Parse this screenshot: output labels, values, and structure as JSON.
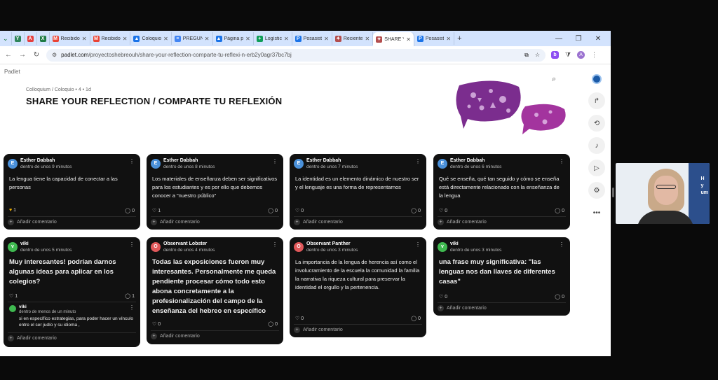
{
  "browser": {
    "tabs": [
      {
        "label": "",
        "fav": "Y",
        "color": "#2f855a"
      },
      {
        "label": "",
        "fav": "A",
        "color": "#e53e3e"
      },
      {
        "label": "",
        "fav": "X",
        "color": "#1e7b45"
      },
      {
        "label": "Recibido",
        "fav": "M",
        "color": "#ea4335"
      },
      {
        "label": "Recibido",
        "fav": "M",
        "color": "#ea4335"
      },
      {
        "label": "Coloquio",
        "fav": "▲",
        "color": "#1a73e8"
      },
      {
        "label": "PREGUN",
        "fav": "≡",
        "color": "#4285f4"
      },
      {
        "label": "Página p",
        "fav": "▲",
        "color": "#1a73e8"
      },
      {
        "label": "Logístic",
        "fav": "+",
        "color": "#0f9d58"
      },
      {
        "label": "Posasist",
        "fav": "P",
        "color": "#1a73e8"
      },
      {
        "label": "Reciente",
        "fav": "✦",
        "color": "#b34d4d"
      },
      {
        "label": "SHARE Y",
        "fav": "✦",
        "color": "#b34d4d",
        "active": true
      },
      {
        "label": "Posasist",
        "fav": "P",
        "color": "#1a73e8"
      }
    ],
    "new_tab": "+",
    "url_host": "padlet.com",
    "url_path": "/proyectoshebreouh/share-your-reflection-comparte-tu-reflexi-n-erb2y0agr37bc7bj",
    "profile_initial": "A",
    "ext_initial": "b"
  },
  "page": {
    "brand": "Padlet",
    "breadcrumb": "Colloquium / Coloquio • 4 • 1d",
    "title": "SHARE YOUR REFLECTION / COMPARTE TU REFLEXIÓN",
    "add_comment": "Añadir comentario",
    "fab": "+"
  },
  "cards": [
    {
      "author": "Esther Dabbah",
      "when": "dentro de unos 9 minutos",
      "body": "La lengua tiene la capacidad de conectar a las personas",
      "likes": "1",
      "comments": "0",
      "avatar": "E",
      "avatar_color": "#4a90d9",
      "liked": true
    },
    {
      "author": "Esther Dabbah",
      "when": "dentro de unos 8 minutos",
      "body": "Los materiales de enseñanza deben ser significativos para los estudiantes y es por ello que debemos conocer a \"nuestro público\"",
      "likes": "1",
      "comments": "0",
      "avatar": "E",
      "avatar_color": "#4a90d9"
    },
    {
      "author": "Esther Dabbah",
      "when": "dentro de unos 7 minutos",
      "body": "La identidad es un elemento dinámico de nuestro ser y el lenguaje es una forma de representarnos",
      "likes": "0",
      "comments": "0",
      "avatar": "E",
      "avatar_color": "#4a90d9"
    },
    {
      "author": "Esther Dabbah",
      "when": "dentro de unos 6 minutos",
      "body": "Qué se enseña, qué tan seguido y cómo se enseña está directamente relacionado con la enseñanza de la lengua",
      "likes": "0",
      "comments": "0",
      "avatar": "E",
      "avatar_color": "#4a90d9"
    },
    {
      "author": "viki",
      "when": "dentro de unos 5 minutos",
      "body": "Muy interesantes! podrían darnos algunas ideas para aplicar en los colegios?",
      "likes": "1",
      "comments": "1",
      "avatar": "v",
      "avatar_color": "#3fb950",
      "big": true,
      "reply": {
        "author": "viki",
        "when": "dentro de menos de un minuto",
        "text": "si en específico estrategias, para poder hacer un vínculo entre el ser judío y su idioma ,"
      }
    },
    {
      "author": "Observant Lobster",
      "when": "dentro de unos 4 minutos",
      "body": "Todas las exposiciones fueron muy interesantes. Personalmente me queda pendiente procesar cómo todo esto abona concretamente a la profesionalización del campo de la enseñanza del hebreo en específico",
      "likes": "0",
      "comments": "0",
      "avatar": "O",
      "avatar_color": "#e0585a",
      "big": true
    },
    {
      "author": "Observant Panther",
      "when": "dentro de unos 3 minutos",
      "body": "La importancia de la lengua de herencia así como el involucramiento de la escuela la comunidad  la familia la narrativa  la riqueza cultural para preservar la identidad el orgullo y la pertenencia.",
      "likes": "0",
      "comments": "0",
      "avatar": "O",
      "avatar_color": "#e0585a"
    },
    {
      "author": "viki",
      "when": "dentro de unos 3 minutos",
      "body": "una frase muy significativa: \"las lenguas nos dan llaves de diferentes casas\"",
      "likes": "0",
      "comments": "0",
      "avatar": "v",
      "avatar_color": "#3fb950",
      "big": true
    }
  ],
  "webcam": {
    "sign": "H\ny\num"
  }
}
